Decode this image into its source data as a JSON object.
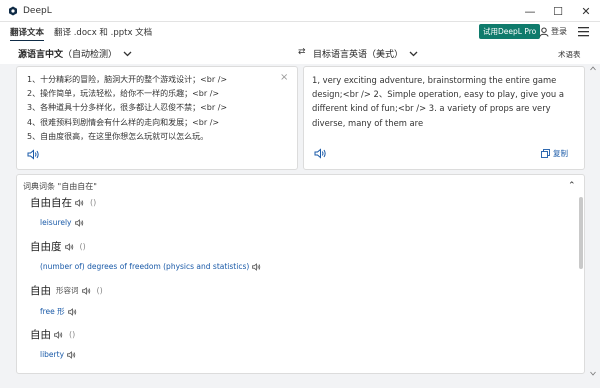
{
  "window": {
    "title": "DeepL",
    "minimize": "—",
    "maximize": "☐",
    "close": "✕"
  },
  "nav": {
    "tabs": [
      "翻译文本",
      "翻译 .docx 和 .pptx 文档"
    ],
    "pro_button": "试用DeepL Pro",
    "login": "登录"
  },
  "langbar": {
    "source_main": "源语言中文",
    "source_detect": "（自动检测）",
    "swap": "⇄",
    "target": "目标语言英语（美式）",
    "glossary": "术语表"
  },
  "source": {
    "lines": [
      "1、十分精彩的冒险，脑洞大开的整个游戏设计；<br />",
      "2、操作简单，玩法轻松，给你不一样的乐趣；<br />",
      "3、各种道具十分多样化，很多都让人忍俊不禁；<br />",
      "4、很难预料到剧情会有什么样的走向和发展；<br />",
      "5、自由度很高，在这里你想怎么玩就可以怎么玩。"
    ],
    "clear": "×"
  },
  "target": {
    "text": "1, very exciting adventure, brainstorming the entire game design;<br /> 2、Simple operation, easy to play, give you a different kind of fun;<br /> 3. a variety of props are very diverse, many of them are",
    "copy": "复制"
  },
  "dictionary": {
    "title": "词典词条 \"自由自在\"",
    "collapse": "⌃",
    "entries": [
      {
        "word": "自由自在",
        "pos": "",
        "paren": "()",
        "translation": "leisurely"
      },
      {
        "word": "自由度",
        "pos": "",
        "paren": "()",
        "translation": "(number of) degrees of freedom (physics and statistics)"
      },
      {
        "word": "自由",
        "pos": "形容词",
        "paren": "()",
        "translation": "free 形"
      },
      {
        "word": "自由",
        "pos": "",
        "paren": "()",
        "translation": "liberty"
      }
    ]
  },
  "colors": {
    "pro": "#0f7b6c",
    "link": "#1a5aa8",
    "navy": "#0f2b46"
  }
}
